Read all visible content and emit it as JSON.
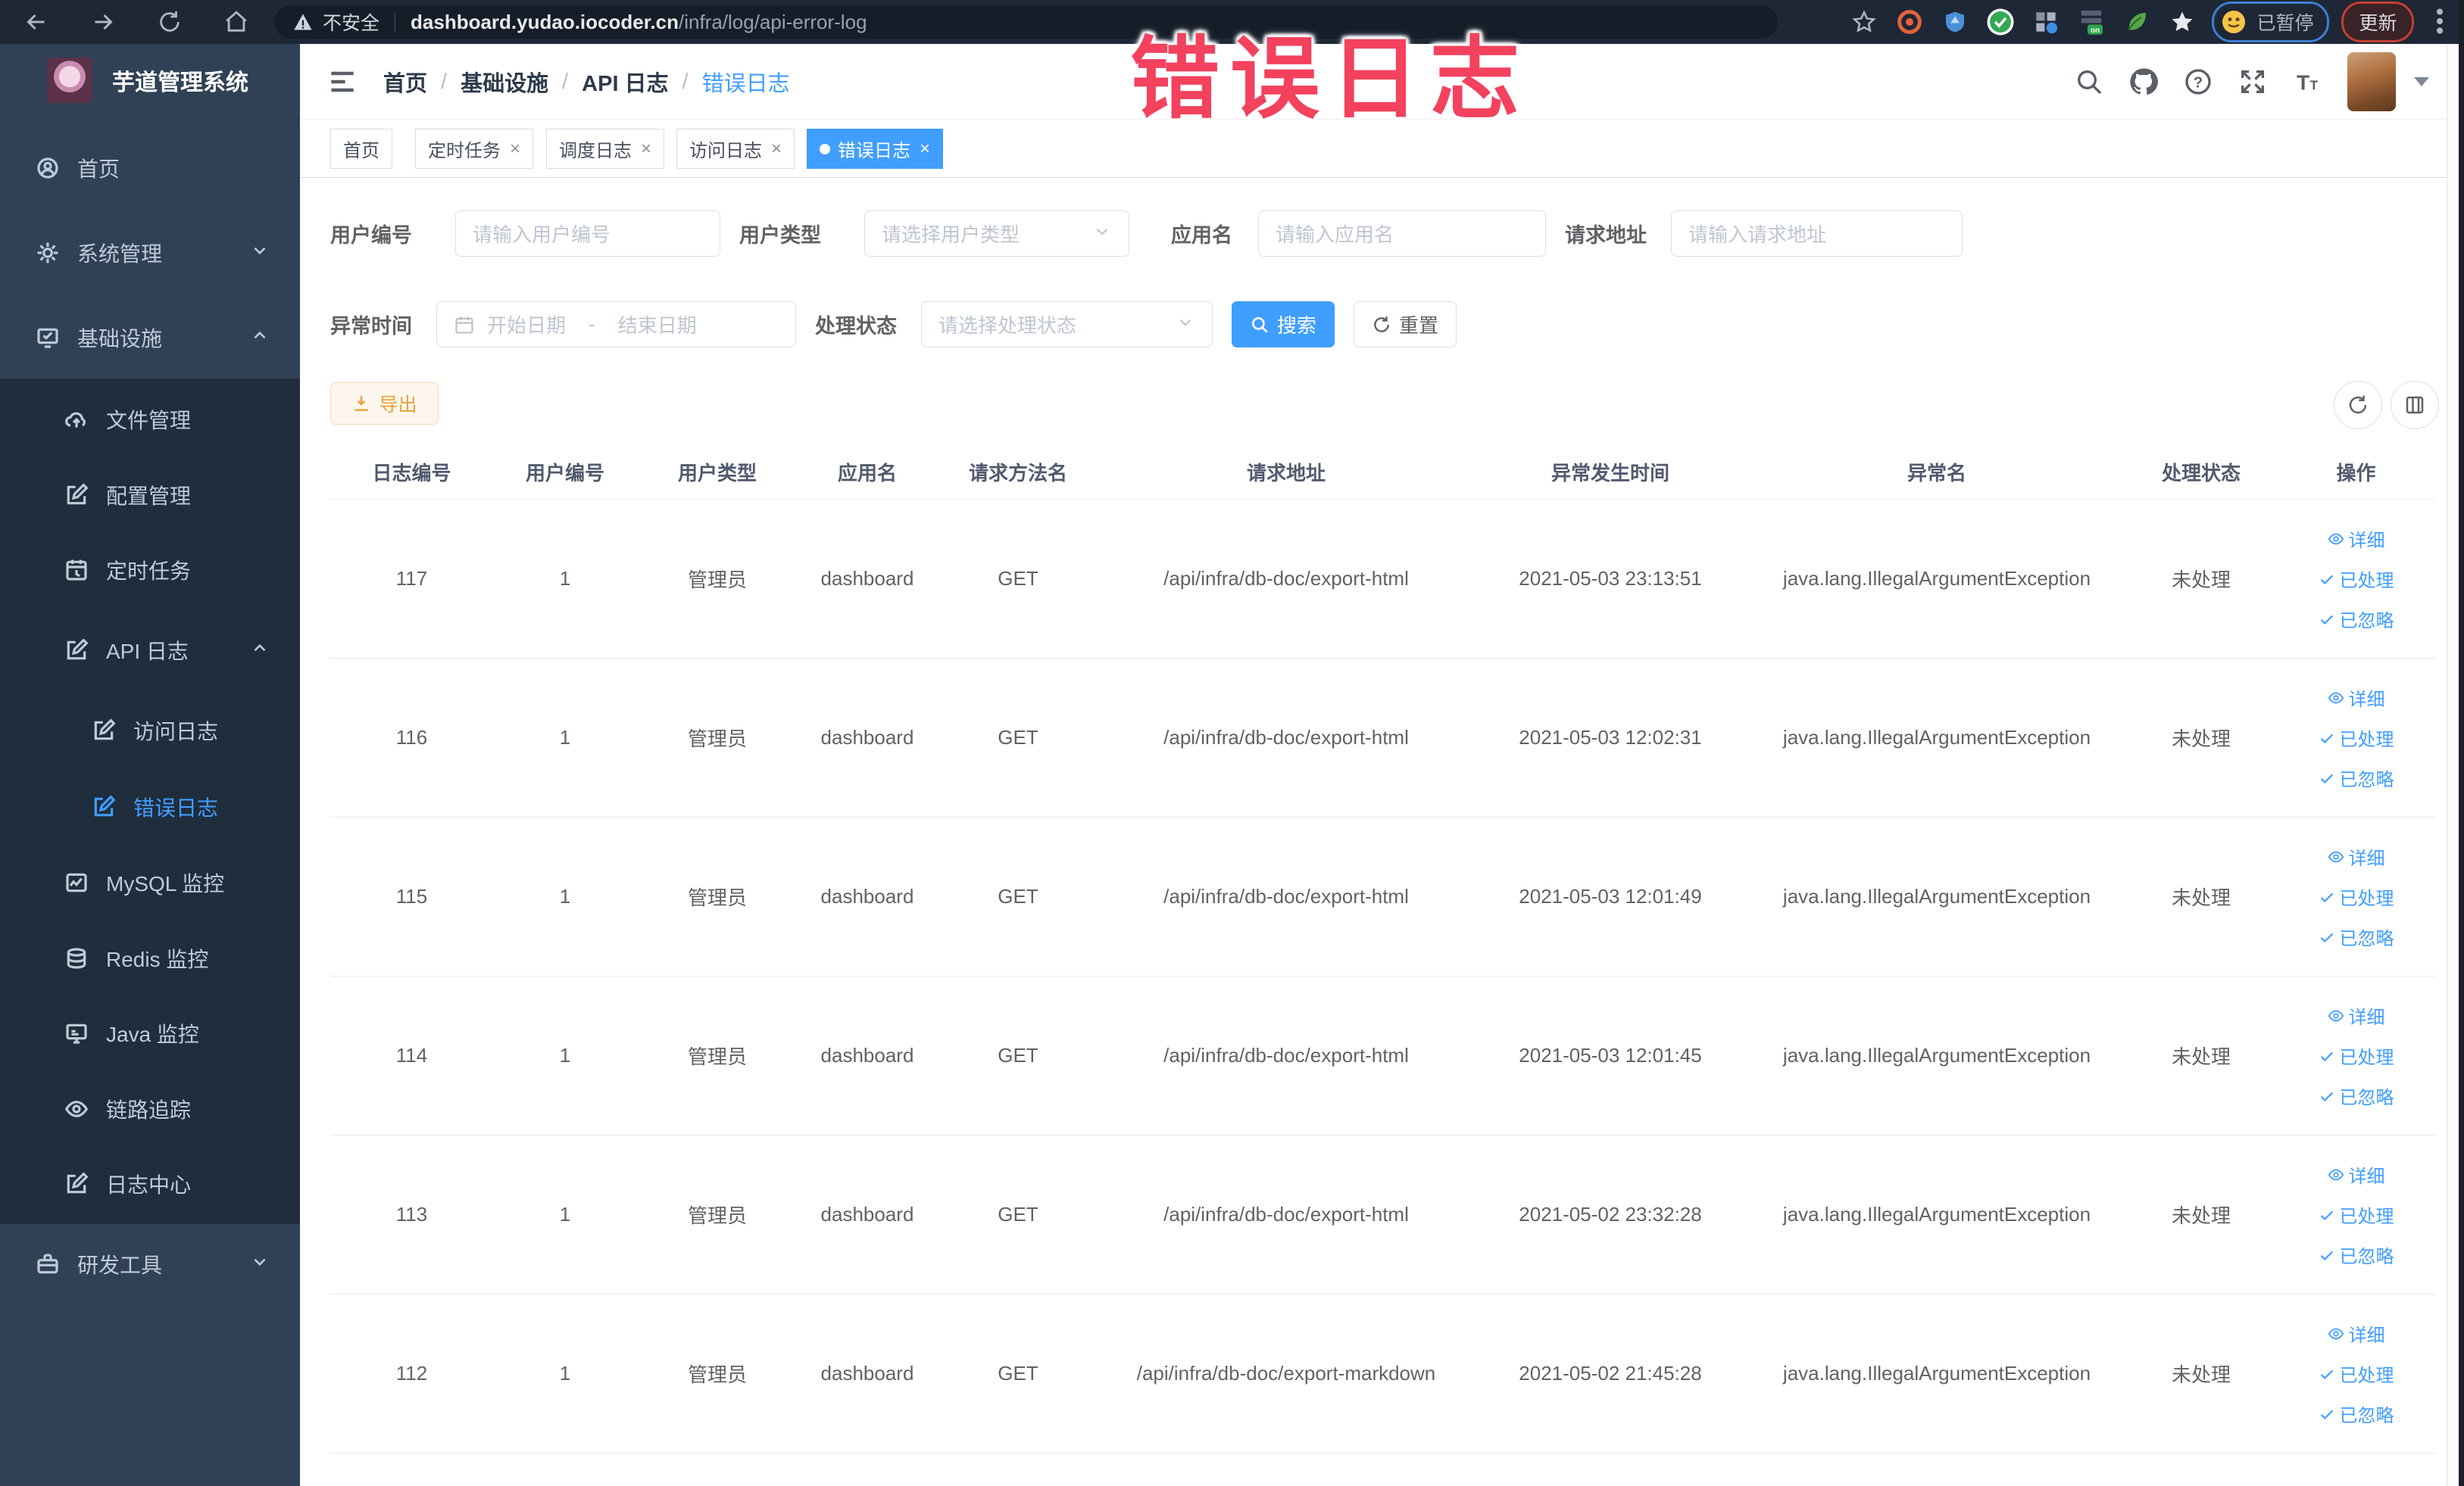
{
  "browser": {
    "security_label": "不安全",
    "url_domain": "dashboard.yudao.iocoder.cn",
    "url_path": "/infra/log/api-error-log",
    "paused_badge": "已暂停",
    "update_button": "更新"
  },
  "annotation": {
    "text": "错误日志",
    "color": "#f3415e"
  },
  "sidebar": {
    "logo_title": "芋道管理系统",
    "items": [
      {
        "label": "首页"
      },
      {
        "label": "系统管理"
      },
      {
        "label": "基础设施"
      },
      {
        "label": "文件管理"
      },
      {
        "label": "配置管理"
      },
      {
        "label": "定时任务"
      },
      {
        "label": "API 日志"
      },
      {
        "label": "访问日志"
      },
      {
        "label": "错误日志"
      },
      {
        "label": "MySQL 监控"
      },
      {
        "label": "Redis 监控"
      },
      {
        "label": "Java 监控"
      },
      {
        "label": "链路追踪"
      },
      {
        "label": "日志中心"
      },
      {
        "label": "研发工具"
      }
    ]
  },
  "breadcrumb": {
    "items": [
      "首页",
      "基础设施",
      "API 日志",
      "错误日志"
    ]
  },
  "tabs": [
    {
      "label": "首页"
    },
    {
      "label": "定时任务"
    },
    {
      "label": "调度日志"
    },
    {
      "label": "访问日志"
    },
    {
      "label": "错误日志"
    }
  ],
  "filters": {
    "user_id": {
      "label": "用户编号",
      "placeholder": "请输入用户编号"
    },
    "user_type": {
      "label": "用户类型",
      "placeholder": "请选择用户类型"
    },
    "app_name": {
      "label": "应用名",
      "placeholder": "请输入应用名"
    },
    "request_url": {
      "label": "请求地址",
      "placeholder": "请输入请求地址"
    },
    "exception_time": {
      "label": "异常时间",
      "start_placeholder": "开始日期",
      "separator": "-",
      "end_placeholder": "结束日期"
    },
    "process_status": {
      "label": "处理状态",
      "placeholder": "请选择处理状态"
    },
    "search_button": "搜索",
    "reset_button": "重置"
  },
  "toolbar": {
    "export_button": "导出"
  },
  "table": {
    "columns": [
      "日志编号",
      "用户编号",
      "用户类型",
      "应用名",
      "请求方法名",
      "请求地址",
      "异常发生时间",
      "异常名",
      "处理状态",
      "操作"
    ],
    "actions": {
      "detail": "详细",
      "processed": "已处理",
      "ignored": "已忽略"
    },
    "rows": [
      {
        "id": "117",
        "user_id": "1",
        "user_type": "管理员",
        "app": "dashboard",
        "method": "GET",
        "url": "/api/infra/db-doc/export-html",
        "time": "2021-05-03 23:13:51",
        "exception": "java.lang.IllegalArgumentException",
        "status": "未处理"
      },
      {
        "id": "116",
        "user_id": "1",
        "user_type": "管理员",
        "app": "dashboard",
        "method": "GET",
        "url": "/api/infra/db-doc/export-html",
        "time": "2021-05-03 12:02:31",
        "exception": "java.lang.IllegalArgumentException",
        "status": "未处理"
      },
      {
        "id": "115",
        "user_id": "1",
        "user_type": "管理员",
        "app": "dashboard",
        "method": "GET",
        "url": "/api/infra/db-doc/export-html",
        "time": "2021-05-03 12:01:49",
        "exception": "java.lang.IllegalArgumentException",
        "status": "未处理"
      },
      {
        "id": "114",
        "user_id": "1",
        "user_type": "管理员",
        "app": "dashboard",
        "method": "GET",
        "url": "/api/infra/db-doc/export-html",
        "time": "2021-05-03 12:01:45",
        "exception": "java.lang.IllegalArgumentException",
        "status": "未处理"
      },
      {
        "id": "113",
        "user_id": "1",
        "user_type": "管理员",
        "app": "dashboard",
        "method": "GET",
        "url": "/api/infra/db-doc/export-html",
        "time": "2021-05-02 23:32:28",
        "exception": "java.lang.IllegalArgumentException",
        "status": "未处理"
      },
      {
        "id": "112",
        "user_id": "1",
        "user_type": "管理员",
        "app": "dashboard",
        "method": "GET",
        "url": "/api/infra/db-doc/export-markdown",
        "time": "2021-05-02 21:45:28",
        "exception": "java.lang.IllegalArgumentException",
        "status": "未处理"
      }
    ]
  }
}
